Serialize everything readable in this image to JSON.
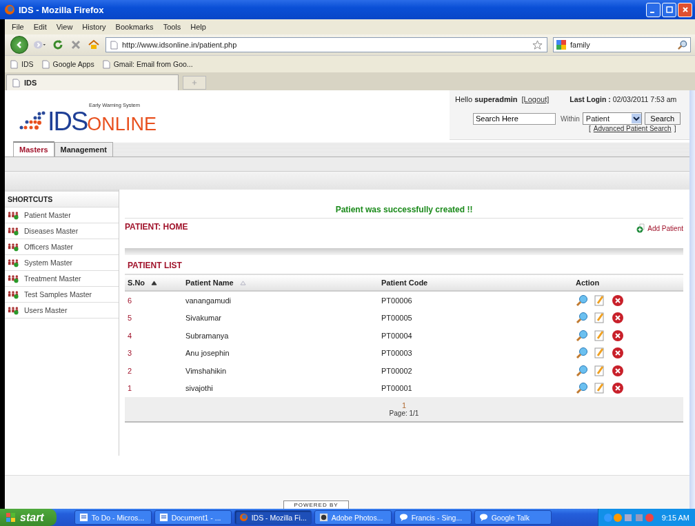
{
  "window": {
    "title": "IDS - Mozilla Firefox"
  },
  "menu": [
    "File",
    "Edit",
    "View",
    "History",
    "Bookmarks",
    "Tools",
    "Help"
  ],
  "address": {
    "url": "http://www.idsonline.in/patient.php"
  },
  "web_search": {
    "value": "family"
  },
  "bookmarks": [
    "IDS",
    "Google Apps",
    "Gmail: Email from Goo..."
  ],
  "browser_tabs": [
    {
      "label": "IDS",
      "selected": true
    }
  ],
  "header": {
    "tagline": "Early Warning System",
    "logo_left": "IDS",
    "logo_right": "ONLINE",
    "greeting": "Hello",
    "user": "superadmin",
    "logout": "[Logout]",
    "last_login_label": "Last Login :",
    "last_login": "02/03/2011 7:53 am",
    "search_value": "Search Here",
    "within": "Within",
    "scope": "Patient",
    "search_button": "Search",
    "advanced_open": "[",
    "advanced": "Advanced Patient Search",
    "advanced_close": "]"
  },
  "nav_tabs": [
    {
      "label": "Masters",
      "selected": true
    },
    {
      "label": "Management",
      "selected": false
    }
  ],
  "sidebar": {
    "title": "SHORTCUTS",
    "items": [
      "Patient Master",
      "Diseases Master",
      "Officers Master",
      "System Master",
      "Treatment Master",
      "Test Samples Master",
      "Users Master"
    ]
  },
  "message": "Patient was successfully created !!",
  "page_title": "PATIENT: HOME",
  "add_link": "Add Patient",
  "list_title": "PATIENT LIST",
  "table": {
    "columns": [
      {
        "label": "S.No",
        "sorted": true
      },
      {
        "label": "Patient Name",
        "sorted": false
      },
      {
        "label": "Patient Code"
      },
      {
        "label": "Action"
      }
    ],
    "rows": [
      {
        "sno": "6",
        "name": "vanangamudi",
        "code": "PT00006"
      },
      {
        "sno": "5",
        "name": "Sivakumar",
        "code": "PT00005"
      },
      {
        "sno": "4",
        "name": "Subramanya",
        "code": "PT00004"
      },
      {
        "sno": "3",
        "name": "Anu josephin",
        "code": "PT00003"
      },
      {
        "sno": "2",
        "name": "Vimshahikin",
        "code": "PT00002"
      },
      {
        "sno": "1",
        "name": "sivajothi",
        "code": "PT00001"
      }
    ]
  },
  "pager": {
    "page": "1",
    "summary": "Page: 1/1"
  },
  "footer": {
    "powered_by": "POWERED BY"
  },
  "taskbar": {
    "start": "start",
    "tasks": [
      {
        "label": "To Do - Micros...",
        "kind": "doc",
        "selected": false
      },
      {
        "label": "Document1 - ...",
        "kind": "doc",
        "selected": false
      },
      {
        "label": "IDS - Mozilla Fi...",
        "kind": "firefox",
        "selected": true
      },
      {
        "label": "Adobe Photos...",
        "kind": "photo",
        "selected": false
      },
      {
        "label": "Francis - Sing...",
        "kind": "chat",
        "selected": false
      },
      {
        "label": "Google Talk",
        "kind": "chat",
        "selected": false
      }
    ],
    "clock": "9:15 AM"
  }
}
